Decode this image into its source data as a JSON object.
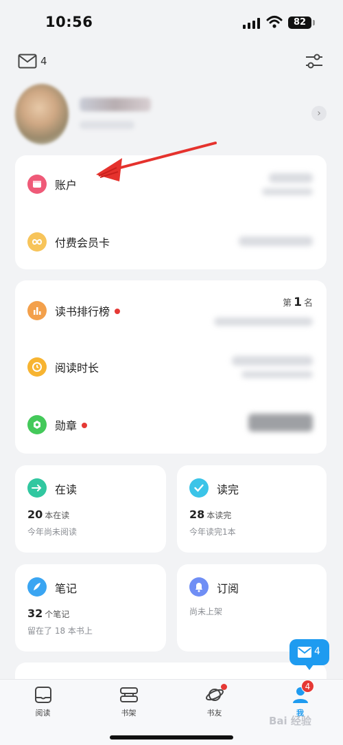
{
  "status_bar": {
    "time": "10:56",
    "battery": "82"
  },
  "header": {
    "mail_count": "4"
  },
  "account_card": {
    "items": [
      {
        "label": "账户",
        "icon": "wallet-icon",
        "color": "#ef5a78"
      },
      {
        "label": "付费会员卡",
        "icon": "infinity-icon",
        "color": "#f7c45a"
      }
    ]
  },
  "reading_card": {
    "rank_prefix": "第",
    "rank_value": "1",
    "rank_suffix": "名",
    "items": [
      {
        "label": "读书排行榜",
        "icon": "bar-chart-icon",
        "color": "#f3a04b",
        "has_dot": true
      },
      {
        "label": "阅读时长",
        "icon": "clock-icon",
        "color": "#f7b431",
        "has_dot": false
      },
      {
        "label": "勋章",
        "icon": "medal-icon",
        "color": "#44c95a",
        "has_dot": true
      }
    ]
  },
  "stats": {
    "reading": {
      "title": "在读",
      "count": "20",
      "count_label": "本在读",
      "sub": "今年尚未阅读",
      "color": "#31c7a0"
    },
    "finished": {
      "title": "读完",
      "count": "28",
      "count_label": "本读完",
      "sub": "今年读完1本",
      "color": "#3bc4e8"
    },
    "notes": {
      "title": "笔记",
      "count": "32",
      "count_label": "个笔记",
      "sub": "留在了 18 本书上",
      "color": "#3aa5f2"
    },
    "subscribe": {
      "title": "订阅",
      "sub": "尚未上架",
      "color": "#6f8ef5"
    }
  },
  "floating_mail": {
    "count": "4"
  },
  "tabbar": {
    "tabs": [
      {
        "label": "阅读",
        "icon": "tablet-icon"
      },
      {
        "label": "书架",
        "icon": "bookshelf-icon"
      },
      {
        "label": "书友",
        "icon": "planet-icon"
      },
      {
        "label": "我",
        "icon": "user-icon",
        "badge": "4"
      }
    ]
  },
  "watermark": "Bai 经验",
  "accent_color": "#1e9bf0"
}
